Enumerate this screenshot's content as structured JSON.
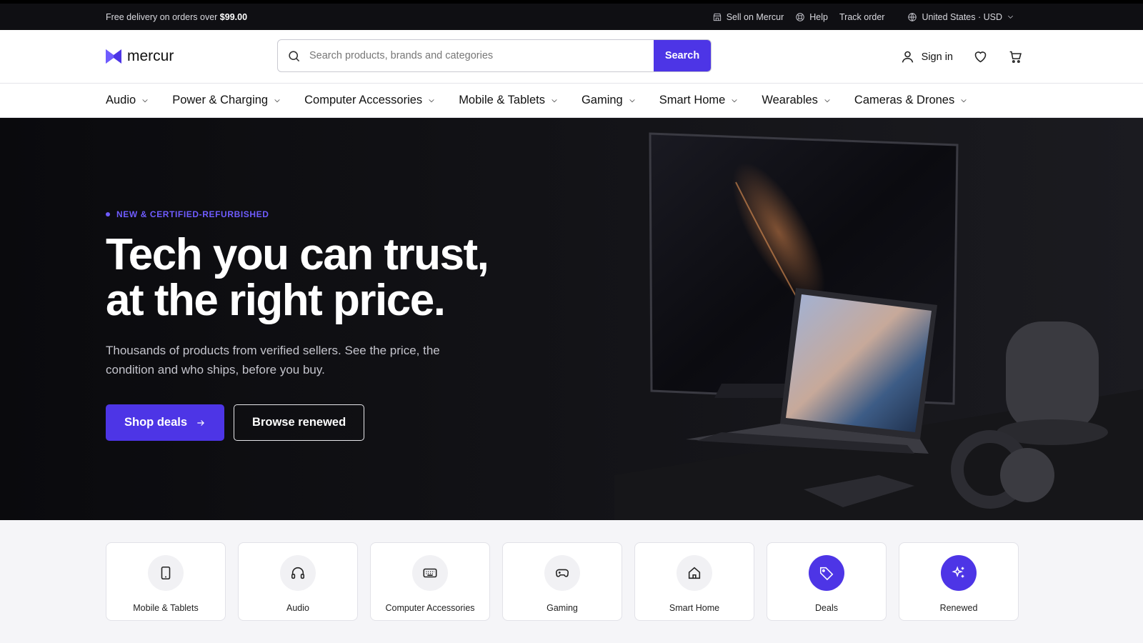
{
  "topbar": {
    "promo_prefix": "Free delivery on orders over ",
    "promo_amount": "$99.00",
    "sell": "Sell on Mercur",
    "help": "Help",
    "track": "Track order",
    "region": "United States · USD"
  },
  "header": {
    "brand": "mercur",
    "search_placeholder": "Search products, brands and categories",
    "search_button": "Search",
    "sign_in": "Sign in"
  },
  "nav": {
    "categories": [
      "Audio",
      "Power & Charging",
      "Computer Accessories",
      "Mobile & Tablets",
      "Gaming",
      "Smart Home",
      "Wearables",
      "Cameras & Drones"
    ]
  },
  "hero": {
    "eyebrow": "NEW & CERTIFIED-REFURBISHED",
    "title_line1": "Tech you can trust,",
    "title_line2": "at the right price.",
    "subtitle": "Thousands of products from verified sellers. See the price, the condition and who ships, before you buy.",
    "primary_cta": "Shop deals",
    "secondary_cta": "Browse renewed"
  },
  "tiles": [
    {
      "label": "Mobile & Tablets",
      "icon": "tablet-icon"
    },
    {
      "label": "Audio",
      "icon": "headphones-icon"
    },
    {
      "label": "Computer Accessories",
      "icon": "keyboard-icon"
    },
    {
      "label": "Gaming",
      "icon": "gamepad-icon"
    },
    {
      "label": "Smart Home",
      "icon": "home-icon"
    },
    {
      "label": "Deals",
      "icon": "tag-icon"
    },
    {
      "label": "Renewed",
      "icon": "sparkles-icon"
    }
  ],
  "colors": {
    "accent": "#4d35e6",
    "topbar": "#0f0f13",
    "hero_bg": "#121216"
  }
}
